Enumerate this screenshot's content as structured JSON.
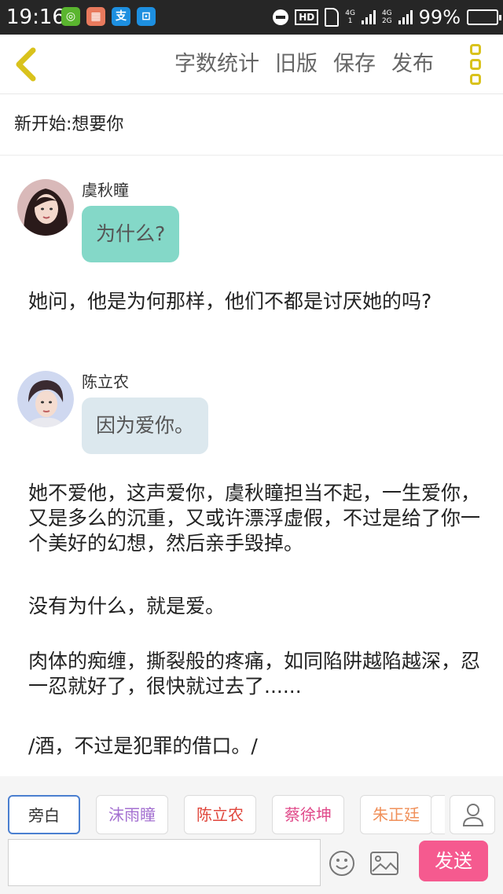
{
  "status_bar": {
    "time": "19:16",
    "network_top": "4G",
    "network_bottom": "1",
    "network2_top": "4G",
    "network2_bottom": "2G",
    "hd": "HD",
    "battery": "99%",
    "battery_level": 0.99,
    "app_icons": [
      {
        "icon": "wechat-pay-icon",
        "glyph": "◎",
        "color": "#5ab52f"
      },
      {
        "icon": "app-icon",
        "glyph": "▦",
        "color": "#e87a5d"
      },
      {
        "icon": "alipay-icon",
        "glyph": "支",
        "color": "#1d8fe0"
      },
      {
        "icon": "scan-icon",
        "glyph": "⊡",
        "color": "#1d8fe0"
      }
    ]
  },
  "toolbar": {
    "actions": [
      "字数统计",
      "旧版",
      "保存",
      "发布"
    ],
    "accent": "#d9c21c"
  },
  "doc": {
    "title": "新开始:想要你"
  },
  "content": {
    "dialog1": {
      "speaker": "虞秋瞳",
      "text": "为什么?",
      "bubble_color": "#84d8c8"
    },
    "narration1": "她问，他是为何那样，他们不都是讨厌她的吗?",
    "dialog2": {
      "speaker": "陈立农",
      "text": "因为爱你。",
      "bubble_color": "#dce8ee"
    },
    "narration2": "她不爱他，这声爱你，虞秋瞳担当不起，一生爱你，又是多么的沉重，又或许漂浮虚假，不过是给了你一个美好的幻想，然后亲手毁掉。",
    "narration3": "没有为什么，就是爱。",
    "narration4": "肉体的痴缠，撕裂般的疼痛，如同陷阱越陷越深，忍一忍就好了，很快就过去了......",
    "narration5": "/酒，不过是犯罪的借口。/"
  },
  "bottom": {
    "characters": [
      {
        "label": "旁白",
        "color": "#333333"
      },
      {
        "label": "沫雨瞳",
        "color": "#a36fd0"
      },
      {
        "label": "陈立农",
        "color": "#e0463c"
      },
      {
        "label": "蔡徐坤",
        "color": "#e04a8a"
      },
      {
        "label": "朱正廷",
        "color": "#f0905a"
      }
    ],
    "send_label": "发送",
    "send_color": "#f55a8f"
  }
}
